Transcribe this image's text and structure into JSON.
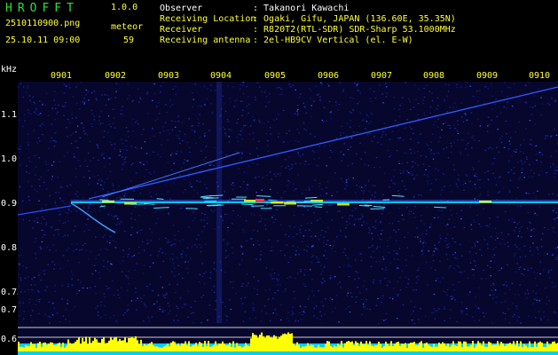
{
  "header": {
    "app_name": "HROFFT",
    "app_version": "1.0.0",
    "file_name": "2510110900.png",
    "datetime": "25.10.11 09:00",
    "meteor_label": "meteor",
    "meteor_count": "59"
  },
  "station": {
    "observer_label": "Observer",
    "observer_value": ": Takanori Kawachi",
    "location_label": "Receiving Location",
    "location_value": ": Ogaki, Gifu, JAPAN (136.60E, 35.35N)",
    "receiver_label": "Receiver",
    "receiver_value": ": R820T2(RTL-SDR) SDR-Sharp 53.1000MHz",
    "antenna_label": "Receiving antenna",
    "antenna_value": ": 2el-HB9CV Vertical (el. E-W)"
  },
  "axis": {
    "y_unit": "kHz",
    "y_ticks": [
      "1.1",
      "1.0",
      "0.9",
      "0.8",
      "0.75",
      "0.7",
      "0.6"
    ],
    "x_ticks": [
      "0901",
      "0902",
      "0903",
      "0904",
      "0905",
      "0906",
      "0907",
      "0908",
      "0909",
      "0910"
    ]
  },
  "colors": {
    "background": "#000000",
    "header_text": "#2fe02f",
    "info_text": "#ffff33",
    "spectrum_noise": "#1a2bbb",
    "signal_cyan": "#00ffff",
    "signal_yellow": "#ffff00",
    "power_bar": "#ffff00"
  }
}
